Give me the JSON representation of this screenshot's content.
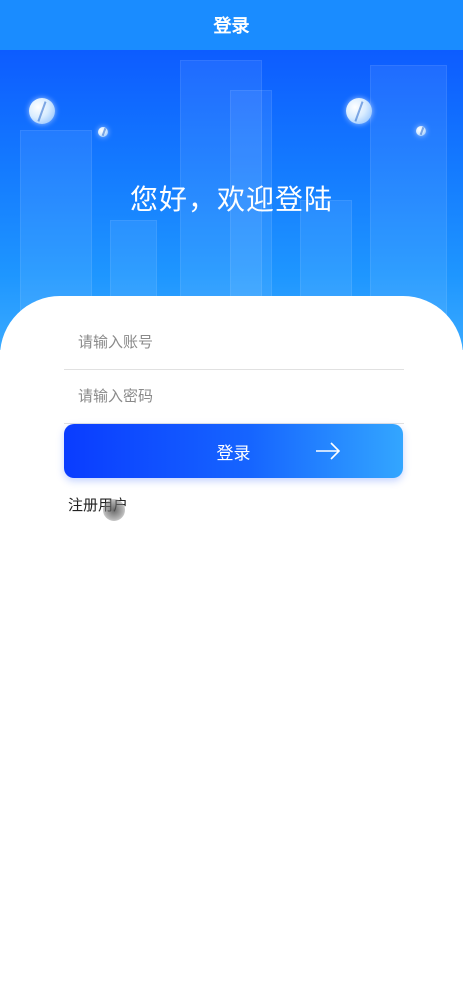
{
  "header": {
    "title": "登录"
  },
  "hero": {
    "welcome_text": "您好，欢迎登陆"
  },
  "form": {
    "account_placeholder": "请输入账号",
    "password_placeholder": "请输入密码",
    "login_button_label": "登录",
    "register_link_label": "注册用户"
  },
  "icons": {
    "globe_left": "globe-icon",
    "globe_right": "globe-icon",
    "arrow": "arrow-right-icon"
  },
  "colors": {
    "header_bg": "#1a8cff",
    "hero_top": "#0d5cff",
    "hero_bottom": "#3aaaff",
    "button_start": "#0a3cff",
    "button_end": "#33a6ff"
  }
}
